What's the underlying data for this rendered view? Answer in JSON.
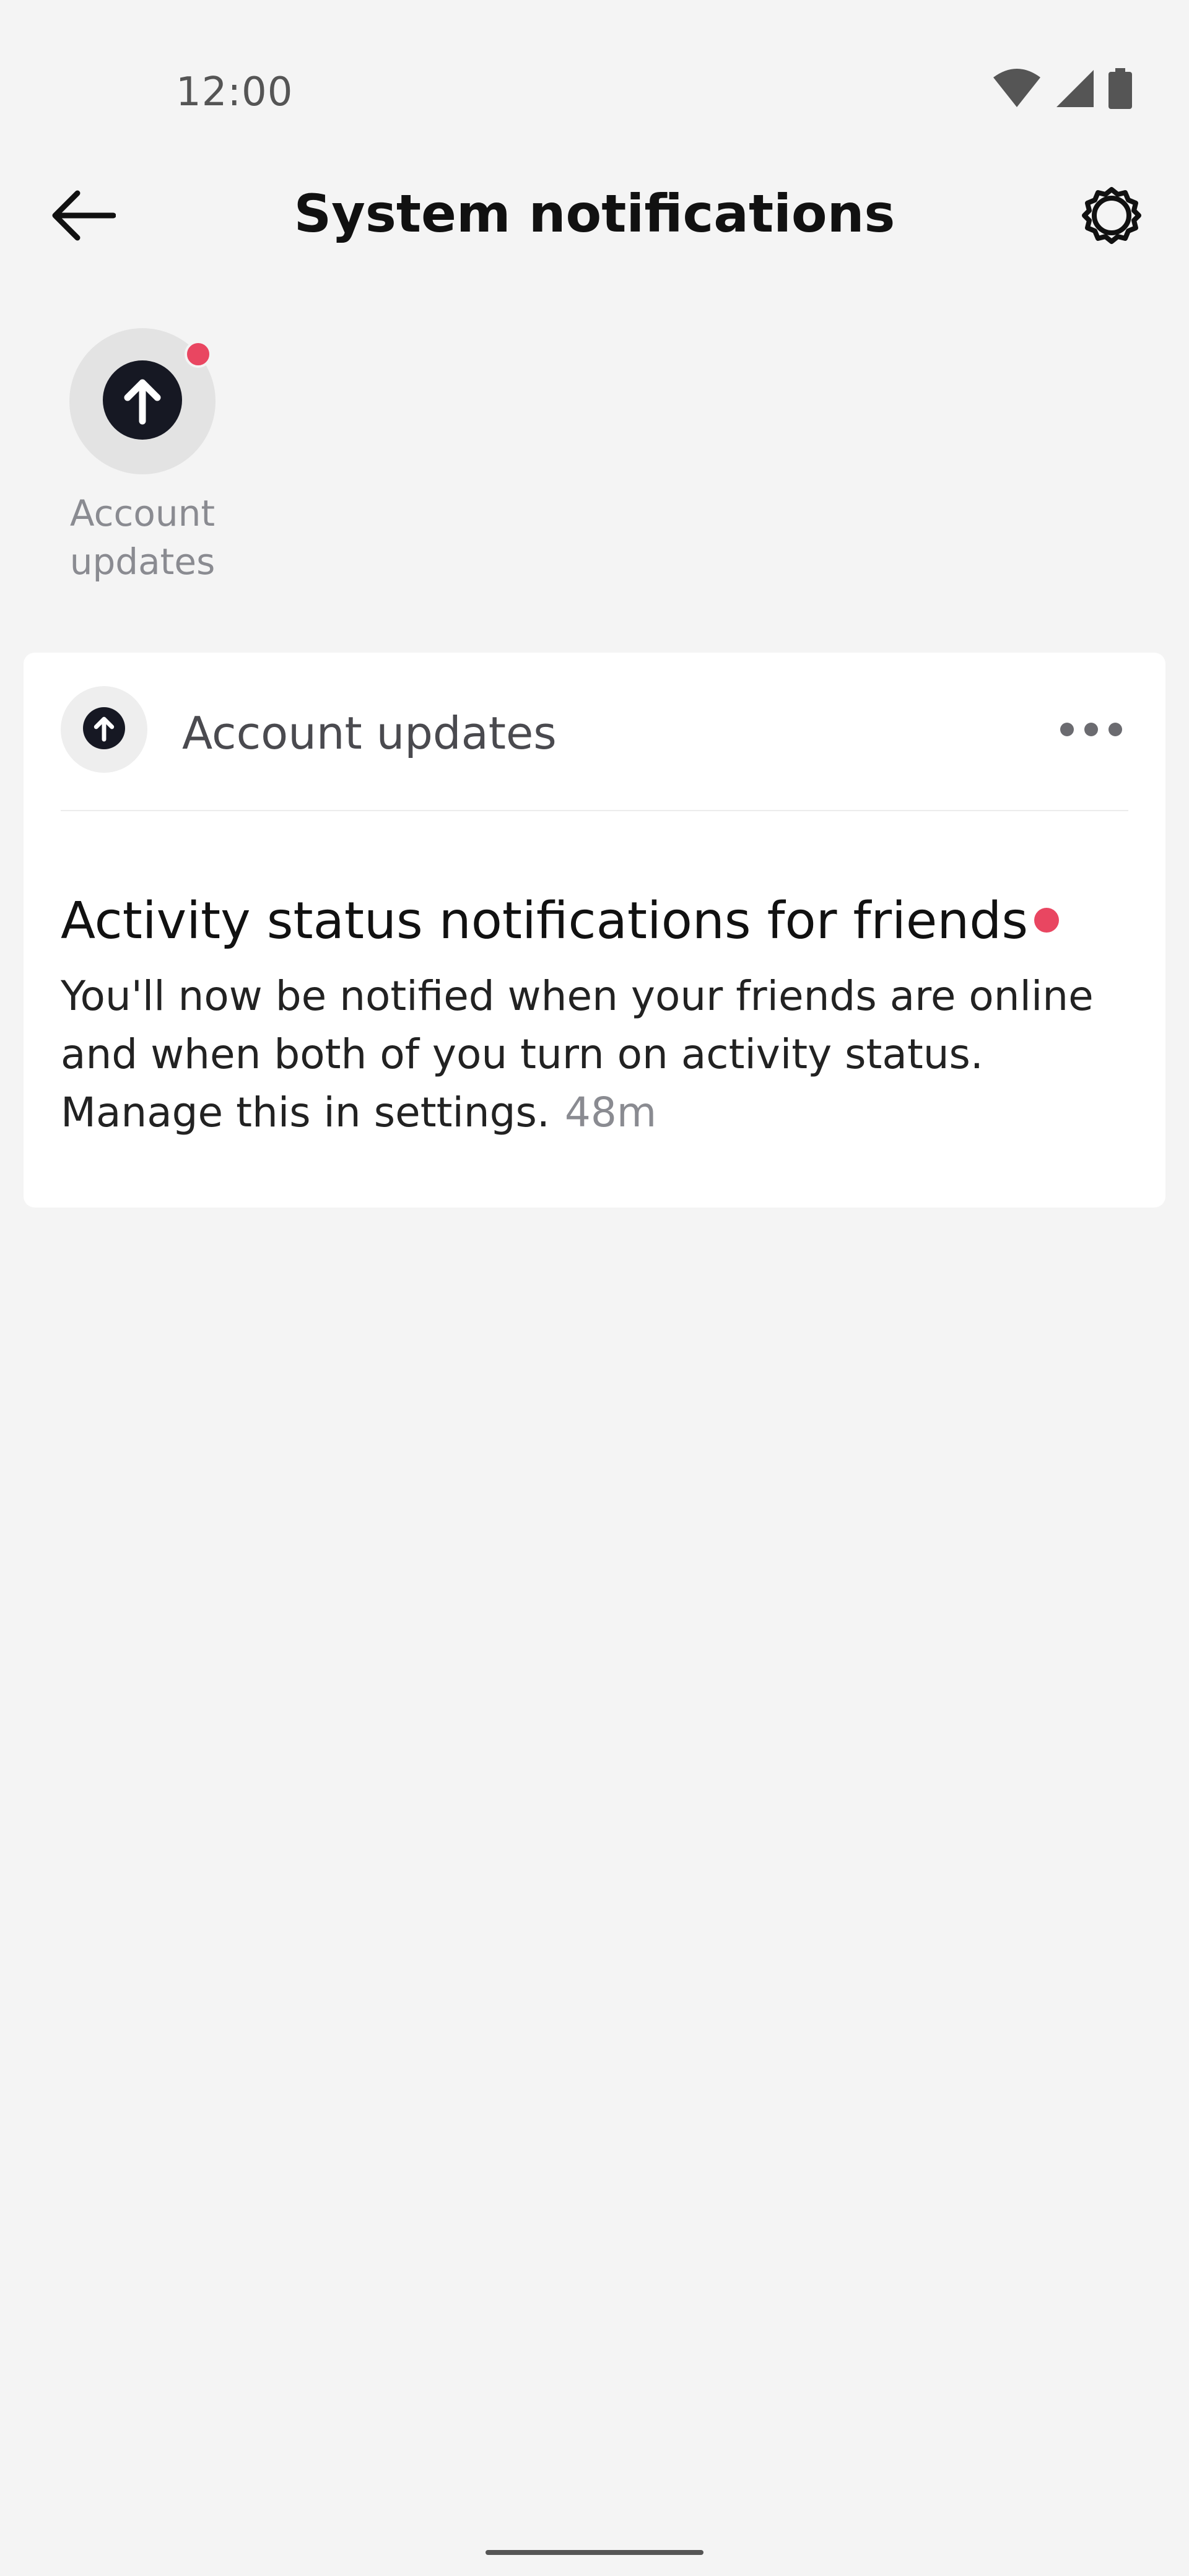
{
  "status_bar": {
    "time": "12:00",
    "icons": [
      "wifi-icon",
      "cellular-signal-icon",
      "battery-icon"
    ]
  },
  "header": {
    "title": "System notifications",
    "back_icon": "arrow-left-icon",
    "settings_icon": "gear-icon"
  },
  "categories": [
    {
      "label": "Account updates",
      "icon": "arrow-up-circle-icon",
      "has_unread": true
    }
  ],
  "card": {
    "source": "Account updates",
    "source_icon": "arrow-up-circle-icon",
    "more_icon": "more-horizontal-icon",
    "notification": {
      "title": "Activity status notifications for friends",
      "body": "You'll now be notified when your friends are online and when both of you turn on activity status. Manage this in settings.",
      "time": "48m",
      "unread": true
    }
  },
  "colors": {
    "background": "#f4f4f4",
    "card": "#ffffff",
    "unread_dot": "#e94661",
    "icon_dark": "#161823",
    "muted_text": "#8a8b91"
  }
}
